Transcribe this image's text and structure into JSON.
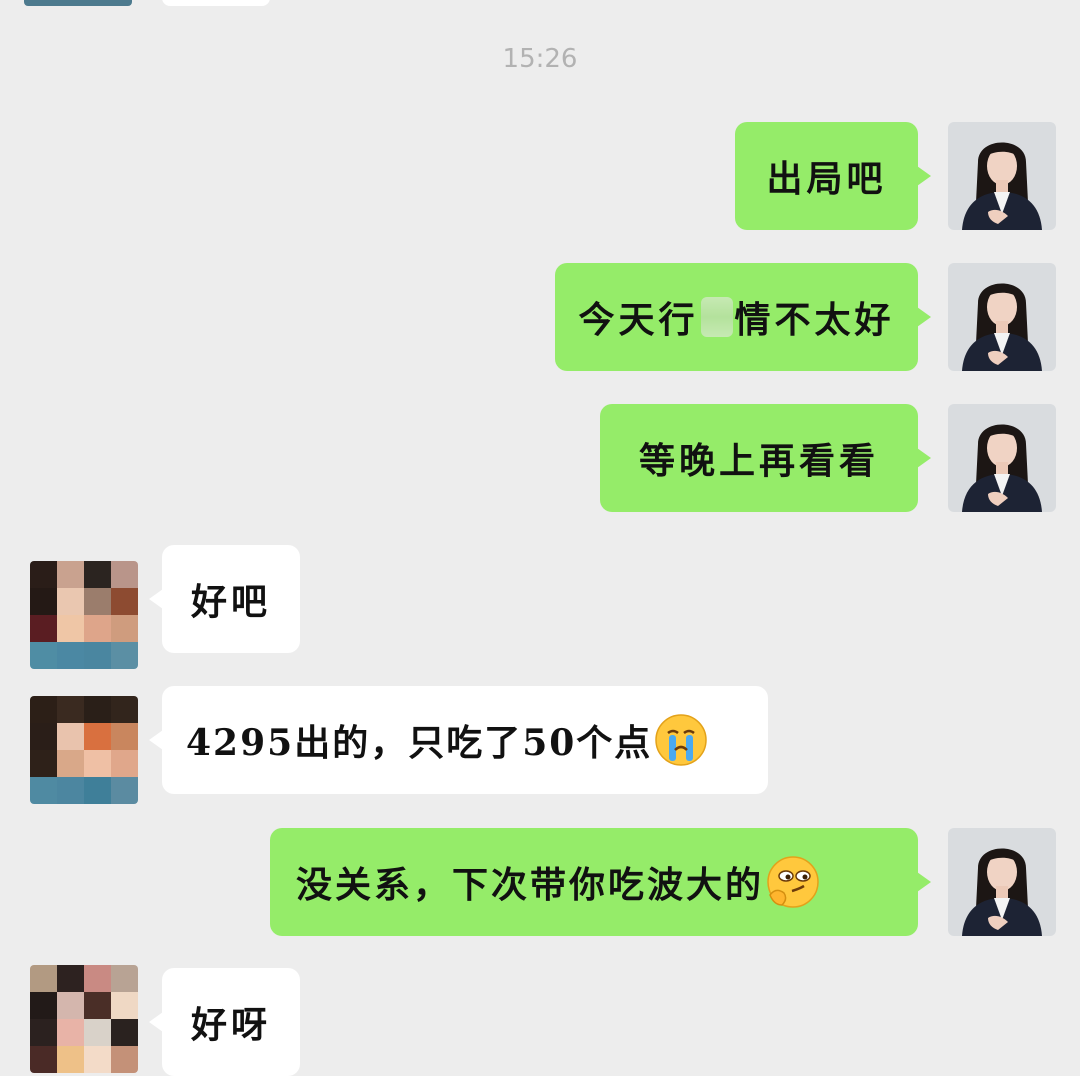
{
  "timestamp": "15:26",
  "colors": {
    "background": "#ededed",
    "my_bubble": "#95ec69",
    "their_bubble": "#ffffff",
    "timestamp_text": "#b2b2b2"
  },
  "messages": [
    {
      "sender": "me",
      "text": "出局吧"
    },
    {
      "sender": "me",
      "text_before": "今天行",
      "text_after": "情不太好"
    },
    {
      "sender": "me",
      "text": "等晚上再看看"
    },
    {
      "sender": "other",
      "text": "好吧"
    },
    {
      "sender": "other",
      "text": "4295出的，只吃了50个点",
      "emoji": "crying-face-emoji"
    },
    {
      "sender": "me",
      "text": "没关系，下次带你吃波大的",
      "emoji": "smirking-thinking-face-emoji"
    },
    {
      "sender": "other",
      "text": "好呀"
    }
  ]
}
